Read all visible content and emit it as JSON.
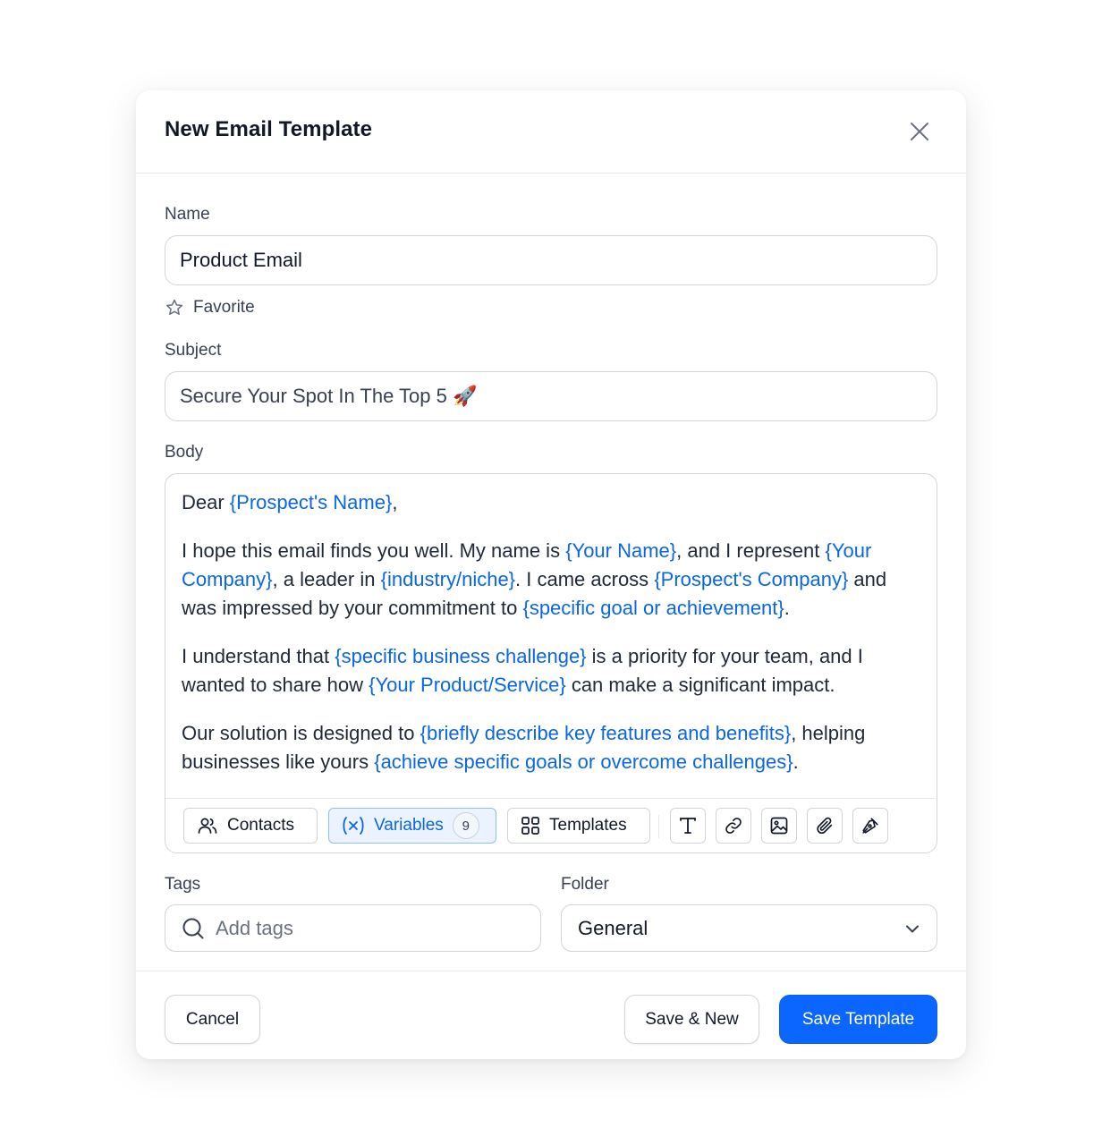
{
  "modal": {
    "title": "New Email Template"
  },
  "form": {
    "name_label": "Name",
    "name_value": "Product Email",
    "favorite_label": "Favorite",
    "subject_label": "Subject",
    "subject_value": "Secure Your Spot In The Top 5 🚀",
    "body_label": "Body",
    "tags_label": "Tags",
    "tags_placeholder": "Add tags",
    "folder_label": "Folder",
    "folder_value": "General"
  },
  "body": {
    "p1": {
      "t1": "Dear ",
      "v1": "{Prospect's Name}",
      "t2": ","
    },
    "p2": {
      "t1": "I hope this email finds you well. My name is ",
      "v1": "{Your Name}",
      "t2": ", and I represent ",
      "v2": "{Your Company}",
      "t3": ", a leader in ",
      "v3": "{industry/niche}",
      "t4": ". I came across ",
      "v4": "{Prospect's Company}",
      "t5": " and was impressed by your commitment to ",
      "v5": "{specific goal or achievement}",
      "t6": "."
    },
    "p3": {
      "t1": "I understand that ",
      "v1": "{specific business challenge}",
      "t2": " is a priority for your team, and I wanted to share how ",
      "v2": "{Your Product/Service}",
      "t3": " can make a significant impact."
    },
    "p4": {
      "t1": "Our solution is designed to ",
      "v1": "{briefly describe key features and benefits}",
      "t2": ", helping businesses like yours ",
      "v2": "{achieve specific goals or overcome challenges}",
      "t3": "."
    }
  },
  "toolbar": {
    "contacts_label": "Contacts",
    "variables_label": "Variables",
    "variables_count": "9",
    "templates_label": "Templates",
    "icons": [
      "text-format-icon",
      "link-icon",
      "image-icon",
      "paperclip-icon",
      "signature-pen-icon"
    ]
  },
  "footer": {
    "cancel_label": "Cancel",
    "save_new_label": "Save & New",
    "save_template_label": "Save Template"
  },
  "colors": {
    "primary": "#0a66ff",
    "variable": "#0a66e8",
    "border": "#d1d5db"
  }
}
